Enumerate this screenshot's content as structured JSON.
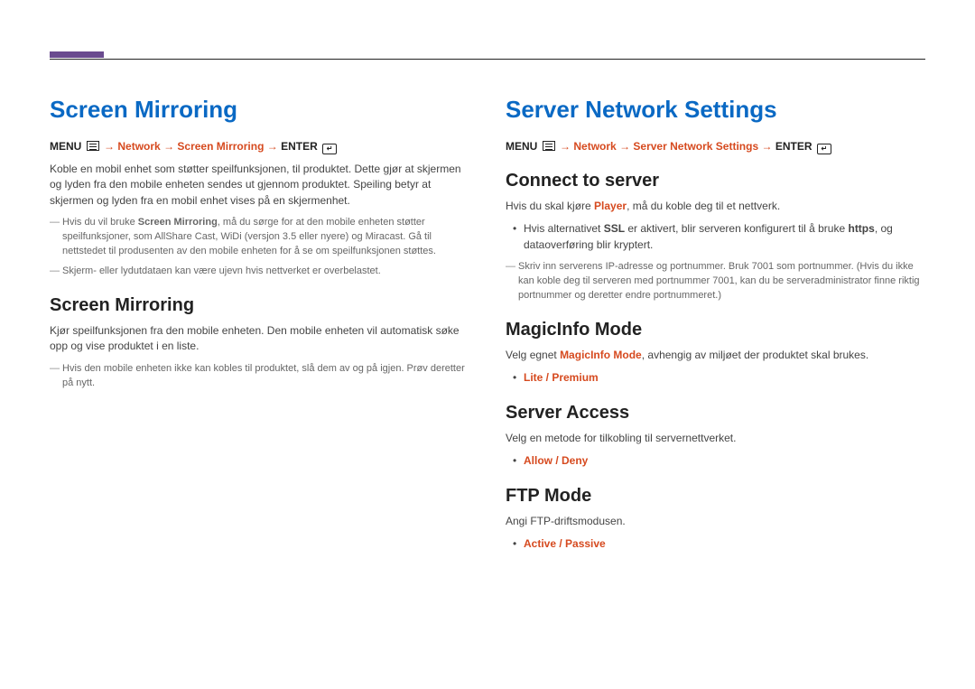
{
  "left": {
    "h1": "Screen Mirroring",
    "menu": {
      "menu": "MENU",
      "arrow": "→",
      "network": "Network",
      "item": "Screen Mirroring",
      "enter": "ENTER"
    },
    "intro": "Koble en mobil enhet som støtter speilfunksjonen, til produktet. Dette gjør at skjermen og lyden fra den mobile enheten sendes ut gjennom produktet. Speiling betyr at skjermen og lyden fra en mobil enhet vises på en skjermenhet.",
    "notes": [
      {
        "pre": "Hvis du vil bruke ",
        "bold": "Screen Mirroring",
        "post": ", må du sørge for at den mobile enheten støtter speilfunksjoner, som AllShare Cast, WiDi (versjon 3.5 eller nyere) og Miracast. Gå til nettstedet til produsenten av den mobile enheten for å se om speilfunksjonen støttes."
      },
      {
        "text": "Skjerm- eller lydutdataen kan være ujevn hvis nettverket er overbelastet."
      }
    ],
    "sub": {
      "h2": "Screen Mirroring",
      "body": "Kjør speilfunksjonen fra den mobile enheten. Den mobile enheten vil automatisk søke opp og vise produktet i en liste.",
      "note": "Hvis den mobile enheten ikke kan kobles til produktet, slå dem av og på igjen. Prøv deretter på nytt."
    }
  },
  "right": {
    "h1": "Server Network Settings",
    "menu": {
      "menu": "MENU",
      "arrow": "→",
      "network": "Network",
      "item": "Server Network Settings",
      "enter": "ENTER"
    },
    "connect": {
      "h2": "Connect to server",
      "body_pre": "Hvis du skal kjøre ",
      "body_hl": "Player",
      "body_post": ", må du koble deg til et nettverk.",
      "bullet_pre": "Hvis alternativet ",
      "bullet_b1": "SSL",
      "bullet_mid": " er aktivert, blir serveren konfigurert til å bruke ",
      "bullet_b2": "https",
      "bullet_post": ", og dataoverføring blir kryptert.",
      "note": "Skriv inn serverens IP-adresse og portnummer. Bruk 7001 som portnummer. (Hvis du ikke kan koble deg til serveren med portnummer 7001, kan du be serveradministrator finne riktig portnummer og deretter endre portnummeret.)"
    },
    "magic": {
      "h2": "MagicInfo Mode",
      "body_pre": "Velg egnet ",
      "body_hl": "MagicInfo Mode",
      "body_post": ", avhengig av miljøet der produktet skal brukes.",
      "option": "Lite / Premium"
    },
    "access": {
      "h2": "Server Access",
      "body": "Velg en metode for tilkobling til servernettverket.",
      "option": "Allow / Deny"
    },
    "ftp": {
      "h2": "FTP Mode",
      "body": "Angi FTP-driftsmodusen.",
      "option": "Active / Passive"
    }
  }
}
